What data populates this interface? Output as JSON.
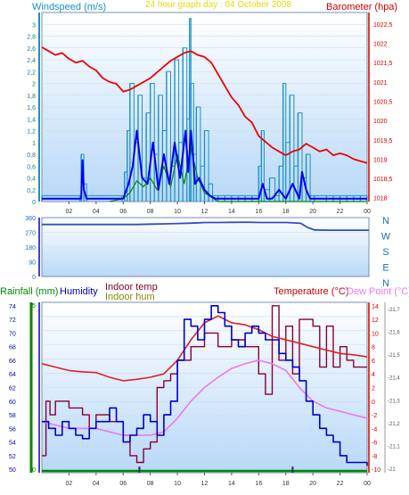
{
  "colors": {
    "wind": "#1890c8",
    "wind_dark": "#0000ee",
    "pressure": "#ee0000",
    "rain": "#008800",
    "humidity": "#0000cc",
    "indoor_temp": "#880033",
    "indoor_hum": "#888800",
    "temperature": "#dd2222",
    "dew_point": "#ee77ee",
    "axis_green": "#008800",
    "axis_blue": "#0000cc",
    "axis_red": "#cc0000",
    "plot_bg_top": "#ffffff",
    "plot_bg_bottom": "#b8d8f8"
  },
  "chart_data": [
    {
      "type": "line",
      "title": "24 hour graph day : 04 October 2008",
      "left_label": "Windspeed (m/s)",
      "right_label": "Barometer (hpa)",
      "x_ticks": [
        "02",
        "04",
        "06",
        "08",
        "10",
        "12",
        "14",
        "16",
        "18",
        "20",
        "22",
        "00"
      ],
      "xlim": [
        0,
        24
      ],
      "left_ylim": [
        0,
        3.2
      ],
      "left_ticks": [
        "0",
        "0,2",
        "0,4",
        "0,6",
        "0,8",
        "1",
        "1,2",
        "1,4",
        "1,6",
        "1,8",
        "2",
        "2,2",
        "2,4",
        "2,6",
        "2,8",
        "3"
      ],
      "right_ylim": [
        1017.9,
        1022.8
      ],
      "right_ticks": [
        "1018",
        "1018,5",
        "1019",
        "1019,5",
        "1020",
        "1020,5",
        "1021",
        "1021,5",
        "1022",
        "1022,5"
      ],
      "series": [
        {
          "role": "wind_gust",
          "axis": "left",
          "x": [
            0,
            2.8,
            2.9,
            3.1,
            3.3,
            5.9,
            6.1,
            6.3,
            6.5,
            6.8,
            7.1,
            7.4,
            7.7,
            8.0,
            8.3,
            8.6,
            8.9,
            9.2,
            9.5,
            9.8,
            10.1,
            10.4,
            10.7,
            10.9,
            11.0,
            11.2,
            11.4,
            11.7,
            12.0,
            12.3,
            12.6,
            13.0,
            13.5,
            14.0,
            14.5,
            15.0,
            15.5,
            16.0,
            16.2,
            16.4,
            16.8,
            17.2,
            17.5,
            17.8,
            18.0,
            18.3,
            18.6,
            18.9,
            19.2,
            19.5,
            19.8,
            20.1,
            21.0,
            21.5,
            22.0,
            22.5,
            23.0,
            23.5,
            24
          ],
          "y": [
            0.1,
            0.1,
            0.8,
            0.3,
            0.1,
            0.1,
            0.5,
            1.2,
            2.0,
            1.0,
            1.8,
            0.4,
            1.5,
            2.0,
            0.8,
            1.8,
            1.2,
            2.2,
            0.6,
            2.4,
            1.0,
            2.6,
            1.4,
            3.1,
            2.0,
            0.8,
            1.6,
            0.6,
            1.2,
            0.3,
            0.1,
            0.1,
            0.1,
            0.1,
            0.1,
            0.1,
            0.1,
            0.6,
            1.2,
            0.2,
            0.4,
            0.1,
            0.6,
            2.0,
            1.0,
            1.8,
            0.6,
            1.5,
            0.4,
            0.8,
            0.1,
            0.1,
            0.1,
            0.1,
            0.1,
            0.1,
            0.1,
            0.1,
            0.1
          ]
        },
        {
          "role": "wind_avg",
          "axis": "left",
          "x": [
            0,
            2.9,
            3.0,
            3.1,
            3.3,
            6.0,
            6.4,
            6.7,
            7.0,
            7.4,
            7.8,
            8.2,
            8.6,
            9.0,
            9.4,
            9.8,
            10.2,
            10.6,
            10.8,
            11.0,
            11.3,
            11.6,
            12.0,
            12.4,
            12.8,
            13.2,
            16.0,
            16.3,
            16.6,
            17.0,
            17.5,
            18.0,
            18.5,
            19.0,
            19.2,
            19.5,
            19.8,
            20.2,
            24
          ],
          "y": [
            0.05,
            0.05,
            0.7,
            0.2,
            0.05,
            0.05,
            0.3,
            0.6,
            1.2,
            0.4,
            0.3,
            1.0,
            0.2,
            0.8,
            0.3,
            1.0,
            0.4,
            1.2,
            0.5,
            1.2,
            0.3,
            0.4,
            0.2,
            0.1,
            0.05,
            0.05,
            0.05,
            0.3,
            0.05,
            0.05,
            0.2,
            0.05,
            0.3,
            0.05,
            0.5,
            0.2,
            0.05,
            0.05,
            0.05
          ]
        },
        {
          "role": "wind_green",
          "axis": "left",
          "x": [
            5.0,
            6.0,
            6.5,
            7.0,
            7.5,
            8.0,
            8.5,
            9.0,
            9.5,
            10.0,
            10.5,
            11.0,
            11.5,
            12.0,
            13.0,
            20.0,
            24
          ],
          "y": [
            0,
            0.05,
            0.15,
            0.35,
            0.25,
            0.4,
            0.2,
            0.6,
            0.25,
            0.8,
            0.3,
            0.9,
            0.4,
            0.15,
            0,
            0,
            0
          ]
        },
        {
          "role": "barometer",
          "axis": "right",
          "x": [
            0,
            0.5,
            1,
            1.5,
            2,
            2.5,
            3,
            3.5,
            4,
            4.5,
            5,
            5.5,
            6,
            6.5,
            7,
            7.5,
            8,
            8.5,
            9,
            9.5,
            10,
            10.5,
            11,
            11.5,
            12,
            12.5,
            13,
            13.5,
            14,
            14.5,
            15,
            15.5,
            16,
            16.5,
            17,
            17.5,
            18,
            18.5,
            19,
            19.5,
            20,
            20.5,
            21,
            21.5,
            22,
            22.5,
            23,
            23.5,
            24
          ],
          "y": [
            1021.9,
            1021.8,
            1021.7,
            1021.75,
            1021.6,
            1021.5,
            1021.55,
            1021.4,
            1021.3,
            1021.1,
            1021.0,
            1020.95,
            1020.75,
            1020.8,
            1020.9,
            1021.0,
            1021.1,
            1021.25,
            1021.4,
            1021.55,
            1021.65,
            1021.75,
            1021.8,
            1021.7,
            1021.65,
            1021.5,
            1021.2,
            1020.9,
            1020.6,
            1020.4,
            1020.1,
            1019.95,
            1019.6,
            1019.45,
            1019.3,
            1019.2,
            1019.1,
            1019.2,
            1019.25,
            1019.4,
            1019.3,
            1019.2,
            1019.25,
            1019.1,
            1019.15,
            1019.1,
            1019.0,
            1018.95,
            1018.9
          ]
        }
      ]
    },
    {
      "type": "line",
      "title": "",
      "right_labels": [
        "N",
        "W",
        "S",
        "E",
        "N"
      ],
      "x_ticks": [],
      "xlim": [
        0,
        24
      ],
      "ylim": [
        0,
        360
      ],
      "y_ticks": [
        "0",
        "90",
        "180",
        "270",
        "360"
      ],
      "series": [
        {
          "role": "wind_direction",
          "x": [
            0,
            1,
            2,
            3,
            4,
            5,
            6,
            7,
            8,
            9,
            10,
            11,
            12,
            13,
            14,
            15,
            16,
            17,
            18,
            19,
            19.5,
            20,
            21,
            22,
            23,
            24
          ],
          "y": [
            318,
            318,
            318,
            318,
            318,
            318,
            318,
            318,
            320,
            322,
            324,
            326,
            330,
            330,
            331,
            332,
            330,
            330,
            330,
            325,
            300,
            285,
            283,
            283,
            283,
            283
          ]
        }
      ]
    },
    {
      "type": "line",
      "title": "",
      "labels": {
        "rainfall": "Rainfall (mm)",
        "humidity": "Humidity",
        "indoor_temp": "Indoor temp",
        "indoor_hum": "Indoor hum",
        "temperature": "Temperature (°C)",
        "dew_point": "Dew Point (°C)"
      },
      "x_ticks": [
        "02",
        "04",
        "06",
        "08",
        "10",
        "12",
        "14",
        "16",
        "18",
        "20",
        "22",
        "00"
      ],
      "xlim": [
        0,
        24
      ],
      "rain_ticks": [
        "0",
        "5"
      ],
      "humidity_ticks": [
        "50",
        "52",
        "54",
        "56",
        "58",
        "60",
        "62",
        "64",
        "66",
        "68",
        "70",
        "72",
        "74"
      ],
      "humidity_ylim": [
        49.5,
        74.5
      ],
      "temperature_ticks": [
        "-10",
        "-8",
        "-6",
        "-4",
        "-2",
        "0",
        "2",
        "4",
        "6",
        "8",
        "10",
        "12",
        "14"
      ],
      "temperature_ylim": [
        -10.5,
        14.5
      ],
      "indoor_ticks": [
        "-21",
        "-21,1",
        "-21,2",
        "-21,3",
        "-21,4",
        "-21,5",
        "-21,6",
        "-21,7"
      ],
      "series": [
        {
          "role": "humidity",
          "axis": "humidity",
          "x": [
            0,
            0.5,
            1,
            1.5,
            2,
            2.5,
            3,
            3.5,
            4,
            4.5,
            5,
            5.5,
            6,
            6.5,
            7,
            7.5,
            8,
            8.5,
            9,
            9.5,
            10,
            10.5,
            11,
            11.5,
            12,
            12.5,
            13,
            13.5,
            14,
            14.5,
            15,
            15.5,
            16,
            16.5,
            17,
            17.5,
            18,
            18.5,
            19,
            19.5,
            20,
            20.5,
            21,
            21.5,
            22,
            22.5,
            23,
            23.5,
            24
          ],
          "y": [
            57,
            56,
            55,
            57,
            56,
            55,
            54.5,
            56,
            57,
            57,
            59,
            57,
            54,
            55,
            56,
            58,
            57,
            55,
            58,
            60,
            66,
            72,
            71,
            69,
            72,
            74,
            73,
            71,
            69,
            68,
            70,
            71,
            70,
            69,
            69,
            67,
            66,
            65,
            63,
            60,
            58,
            56,
            55,
            54,
            52,
            51,
            51,
            51,
            50.5
          ]
        },
        {
          "role": "indoor_temp",
          "axis": "temperature",
          "x": [
            0,
            0.3,
            0.6,
            1,
            2,
            3,
            3.5,
            4,
            5,
            6,
            6.5,
            7,
            7.5,
            8,
            8.5,
            9,
            9.5,
            10,
            11,
            12,
            13,
            14,
            15,
            16,
            16.5,
            17,
            17.5,
            18,
            18.5,
            19,
            19.5,
            20,
            20.5,
            21,
            21.5,
            22,
            22.5,
            23,
            23.5,
            24
          ],
          "y": [
            -8,
            0,
            -2,
            0,
            -1,
            -2,
            -4,
            -2,
            -3,
            -5,
            -8,
            -9,
            -7,
            -6,
            2,
            3,
            4,
            6,
            8,
            10,
            8,
            9,
            8,
            4,
            1,
            14,
            6,
            11,
            4,
            12,
            12,
            11,
            5,
            11,
            5,
            8,
            6,
            5,
            5,
            5
          ]
        },
        {
          "role": "temperature",
          "axis": "temperature",
          "x": [
            0,
            1,
            2,
            3,
            4,
            5,
            6,
            7,
            8,
            9,
            10,
            11,
            12,
            13,
            14,
            15,
            16,
            17,
            18,
            19,
            20,
            21,
            22,
            23,
            24
          ],
          "y": [
            5.5,
            5,
            4.5,
            4.3,
            4.2,
            3.5,
            3.0,
            3.2,
            3.5,
            4.0,
            6,
            9,
            11.5,
            12.5,
            11.5,
            11.2,
            10.5,
            9.5,
            9,
            8.5,
            8,
            7.5,
            7,
            6.8,
            6.5
          ]
        },
        {
          "role": "dew_point",
          "axis": "temperature",
          "x": [
            0,
            1,
            2,
            3,
            4,
            5,
            6,
            7,
            8,
            9,
            10,
            11,
            12,
            13,
            14,
            15,
            16,
            17,
            18,
            19,
            20,
            21,
            22,
            23,
            24
          ],
          "y": [
            -3,
            -3.5,
            -4,
            -4,
            -4,
            -4.5,
            -5,
            -5,
            -5,
            -4.5,
            -2.5,
            0,
            2,
            3.5,
            4.8,
            5.5,
            6,
            5.5,
            4.5,
            2,
            0,
            -1,
            -1.5,
            -2,
            -2.5
          ]
        },
        {
          "role": "rainfall",
          "axis": "rain",
          "x": [
            0,
            24
          ],
          "y": [
            0,
            0
          ]
        }
      ],
      "markers": [
        {
          "x": 7.2,
          "from": -10.5,
          "to": -9.6
        },
        {
          "x": 18.5,
          "from": -10.5,
          "to": -9.6
        }
      ]
    }
  ]
}
